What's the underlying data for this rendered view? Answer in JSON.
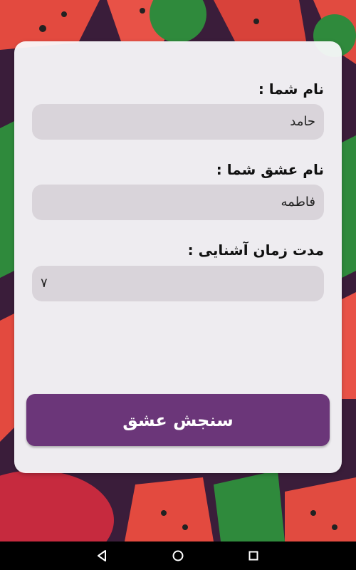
{
  "form": {
    "your_name_label": "نام شما :",
    "your_name_value": "حامد",
    "lover_name_label": "نام عشق شما :",
    "lover_name_value": "فاطمه",
    "acquaintance_label": "مدت زمان آشنایی :",
    "acquaintance_value": "۷",
    "submit_label": "سنجش عشق"
  },
  "colors": {
    "button": "#6b3679",
    "input_bg": "#d9d4da",
    "card_bg": "#f8f7f9",
    "background": "#3a1d3a"
  },
  "icons": {
    "back": "back-triangle-icon",
    "home": "home-circle-icon",
    "recents": "recents-square-icon"
  }
}
